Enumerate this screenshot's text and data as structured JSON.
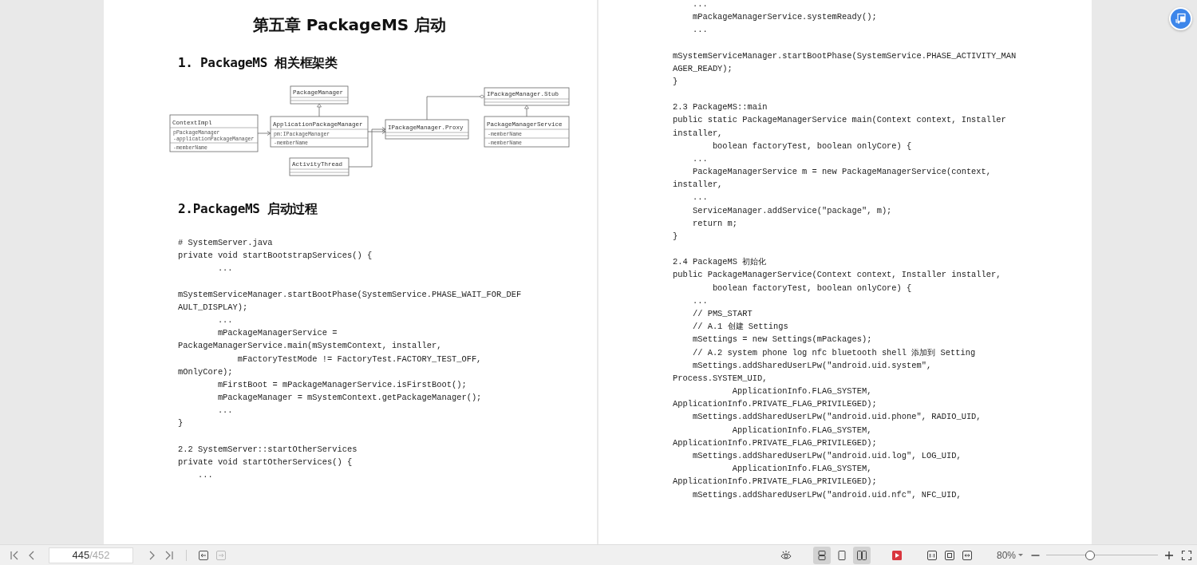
{
  "document": {
    "pages": [
      {
        "title": "第五章 PackageMS 启动",
        "sections": [
          {
            "kind": "heading",
            "text": "1. PackageMS 相关框架类"
          },
          {
            "kind": "diagram",
            "classes": [
              {
                "name": "PackageManager"
              },
              {
                "name": "ContextImpl",
                "attributes": [
                  "pPackageManager",
                  "-applicationPackageManager"
                ],
                "methods": [
                  "-memberName"
                ]
              },
              {
                "name": "ApplicationPackageManager",
                "attributes": [
                  "pm:IPackageManager"
                ],
                "methods": [
                  "-memberName"
                ]
              },
              {
                "name": "ActivityThread"
              },
              {
                "name": "IPackageManager.Proxy"
              },
              {
                "name": "IPackageManager.Stub"
              },
              {
                "name": "PackageManagerService",
                "attributes": [
                  "-memberName"
                ],
                "methods": [
                  "-memberName"
                ]
              }
            ]
          },
          {
            "kind": "heading",
            "text": "2.PackageMS 启动过程"
          },
          {
            "kind": "code",
            "lines": [
              "# SystemServer.java",
              "private void startBootstrapServices() {",
              "        ..."
            ]
          },
          {
            "kind": "code",
            "lines": [
              "mSystemServiceManager.startBootPhase(SystemService.PHASE_WAIT_FOR_DEF",
              "AULT_DISPLAY);",
              "        ...",
              "        mPackageManagerService =",
              "PackageManagerService.main(mSystemContext, installer,",
              "            mFactoryTestMode != FactoryTest.FACTORY_TEST_OFF,",
              "mOnlyCore);",
              "        mFirstBoot = mPackageManagerService.isFirstBoot();",
              "        mPackageManager = mSystemContext.getPackageManager();",
              "        ...",
              "}"
            ]
          },
          {
            "kind": "code",
            "lines": [
              "2.2 SystemServer::startOtherServices",
              "private void startOtherServices() {",
              "    ..."
            ]
          }
        ]
      },
      {
        "sections": [
          {
            "kind": "code",
            "lines": [
              "    ...",
              "    mPackageManagerService.systemReady();",
              "    ..."
            ]
          },
          {
            "kind": "code",
            "lines": [
              "mSystemServiceManager.startBootPhase(SystemService.PHASE_ACTIVITY_MAN",
              "AGER_READY);",
              "}"
            ]
          },
          {
            "kind": "code",
            "lines": [
              "2.3 PackageMS::main",
              "public static PackageManagerService main(Context context, Installer",
              "installer,",
              "        boolean factoryTest, boolean onlyCore) {",
              "    ...",
              "    PackageManagerService m = new PackageManagerService(context,",
              "installer,",
              "    ...",
              "    ServiceManager.addService(\"package\", m);",
              "    return m;",
              "}"
            ]
          },
          {
            "kind": "code",
            "lines": [
              "2.4 PackageMS 初始化",
              "public PackageManagerService(Context context, Installer installer,",
              "        boolean factoryTest, boolean onlyCore) {",
              "    ...",
              "    // PMS_START",
              "    // A.1 创建 Settings",
              "    mSettings = new Settings(mPackages);",
              "    // A.2 system phone log nfc bluetooth shell 添加到 Setting",
              "    mSettings.addSharedUserLPw(\"android.uid.system\",",
              "Process.SYSTEM_UID,",
              "            ApplicationInfo.FLAG_SYSTEM,",
              "ApplicationInfo.PRIVATE_FLAG_PRIVILEGED);",
              "    mSettings.addSharedUserLPw(\"android.uid.phone\", RADIO_UID,",
              "            ApplicationInfo.FLAG_SYSTEM,",
              "ApplicationInfo.PRIVATE_FLAG_PRIVILEGED);",
              "    mSettings.addSharedUserLPw(\"android.uid.log\", LOG_UID,",
              "            ApplicationInfo.FLAG_SYSTEM,",
              "ApplicationInfo.PRIVATE_FLAG_PRIVILEGED);",
              "    mSettings.addSharedUserLPw(\"android.uid.nfc\", NFC_UID,"
            ]
          }
        ]
      }
    ]
  },
  "toolbar": {
    "history": [
      {
        "kind": "back",
        "disabled": false
      },
      {
        "kind": "forward",
        "disabled": true
      }
    ],
    "page_input": "445",
    "page_total": "/452",
    "view_modes": [
      {
        "kind": "continuous",
        "selected": true
      },
      {
        "kind": "single",
        "selected": false
      },
      {
        "kind": "double",
        "selected": true
      }
    ],
    "zoom": "80%",
    "zoom_slider": {
      "level": 0.39
    }
  }
}
